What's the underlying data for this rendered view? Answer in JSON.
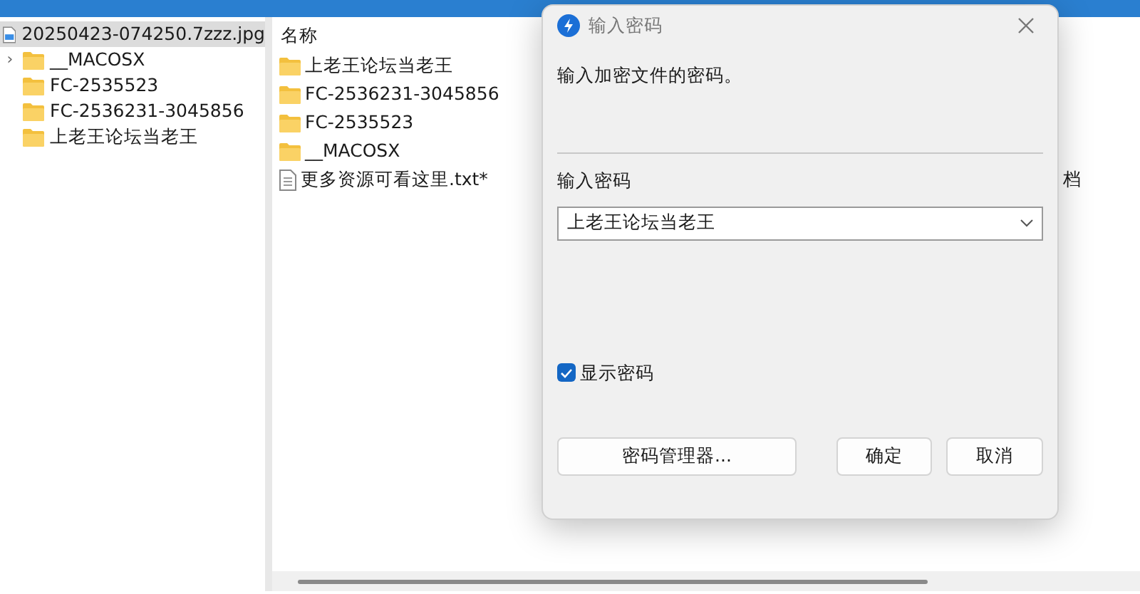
{
  "tree": {
    "label": "20250423-074250.7zzz.jpg",
    "selected": true,
    "children": [
      {
        "label": "__MACOSX",
        "expander": "›"
      },
      {
        "label": "FC-2535523"
      },
      {
        "label": "FC-2536231-3045856"
      },
      {
        "label": "上老王论坛当老王"
      }
    ]
  },
  "file_list": {
    "columns": [
      "名称"
    ],
    "rows": [
      {
        "kind": "folder",
        "name": "上老王论坛当老王"
      },
      {
        "kind": "folder",
        "name": "FC-2536231-3045856"
      },
      {
        "kind": "folder",
        "name": "FC-2535523"
      },
      {
        "kind": "folder",
        "name": "__MACOSX"
      },
      {
        "kind": "file",
        "name": "更多资源可看这里.txt*",
        "column_2": "档"
      }
    ]
  },
  "dialog": {
    "title": "输入密码",
    "message": "输入加密文件的密码。",
    "field_label": "输入密码",
    "password": "上老王论坛当老王",
    "show_password": {
      "label": "显示密码",
      "checked": true
    },
    "buttons": [
      "密码管理器...",
      "确定",
      "取消"
    ]
  }
}
